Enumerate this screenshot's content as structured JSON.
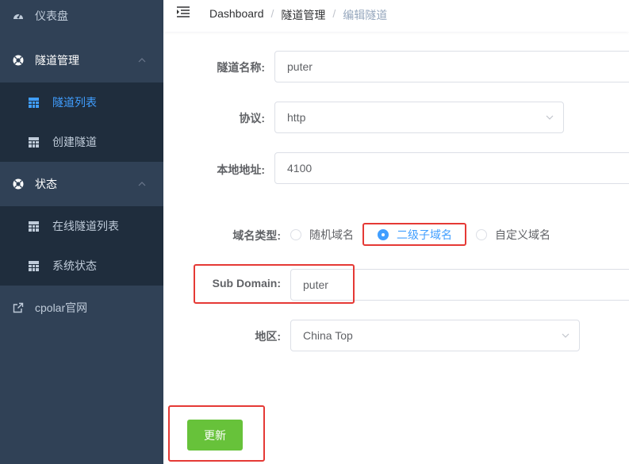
{
  "sidebar": {
    "dashboard": {
      "label": "仪表盘",
      "icon": "dashboard-gauge-icon"
    },
    "tunnel_mgmt": {
      "label": "隧道管理",
      "icon": "lifebuoy-icon",
      "children": [
        {
          "label": "隧道列表",
          "icon": "grid-icon",
          "active": true
        },
        {
          "label": "创建隧道",
          "icon": "grid-icon"
        }
      ]
    },
    "status": {
      "label": "状态",
      "icon": "lifebuoy-icon",
      "children": [
        {
          "label": "在线隧道列表",
          "icon": "grid-icon"
        },
        {
          "label": "系统状态",
          "icon": "grid-icon"
        }
      ]
    },
    "cpolar": {
      "label": "cpolar官网",
      "icon": "external-link-icon"
    }
  },
  "breadcrumb": [
    "Dashboard",
    "隧道管理",
    "编辑隧道"
  ],
  "form": {
    "name": {
      "label": "隧道名称:",
      "value": "puter"
    },
    "protocol": {
      "label": "协议:",
      "value": "http"
    },
    "local_addr": {
      "label": "本地地址:",
      "value": "4100"
    },
    "domain_type": {
      "label": "域名类型:",
      "options": [
        "随机域名",
        "二级子域名",
        "自定义域名"
      ],
      "selected": "二级子域名"
    },
    "sub_domain": {
      "label": "Sub Domain:",
      "value": "puter"
    },
    "region": {
      "label": "地区:",
      "value": "China Top"
    }
  },
  "buttons": {
    "update": "更新"
  },
  "colors": {
    "sidebar_bg": "#304156",
    "submenu_bg": "#1f2d3d",
    "accent": "#409eff",
    "update_button": "#67c23a",
    "highlight_box": "#e53935"
  }
}
